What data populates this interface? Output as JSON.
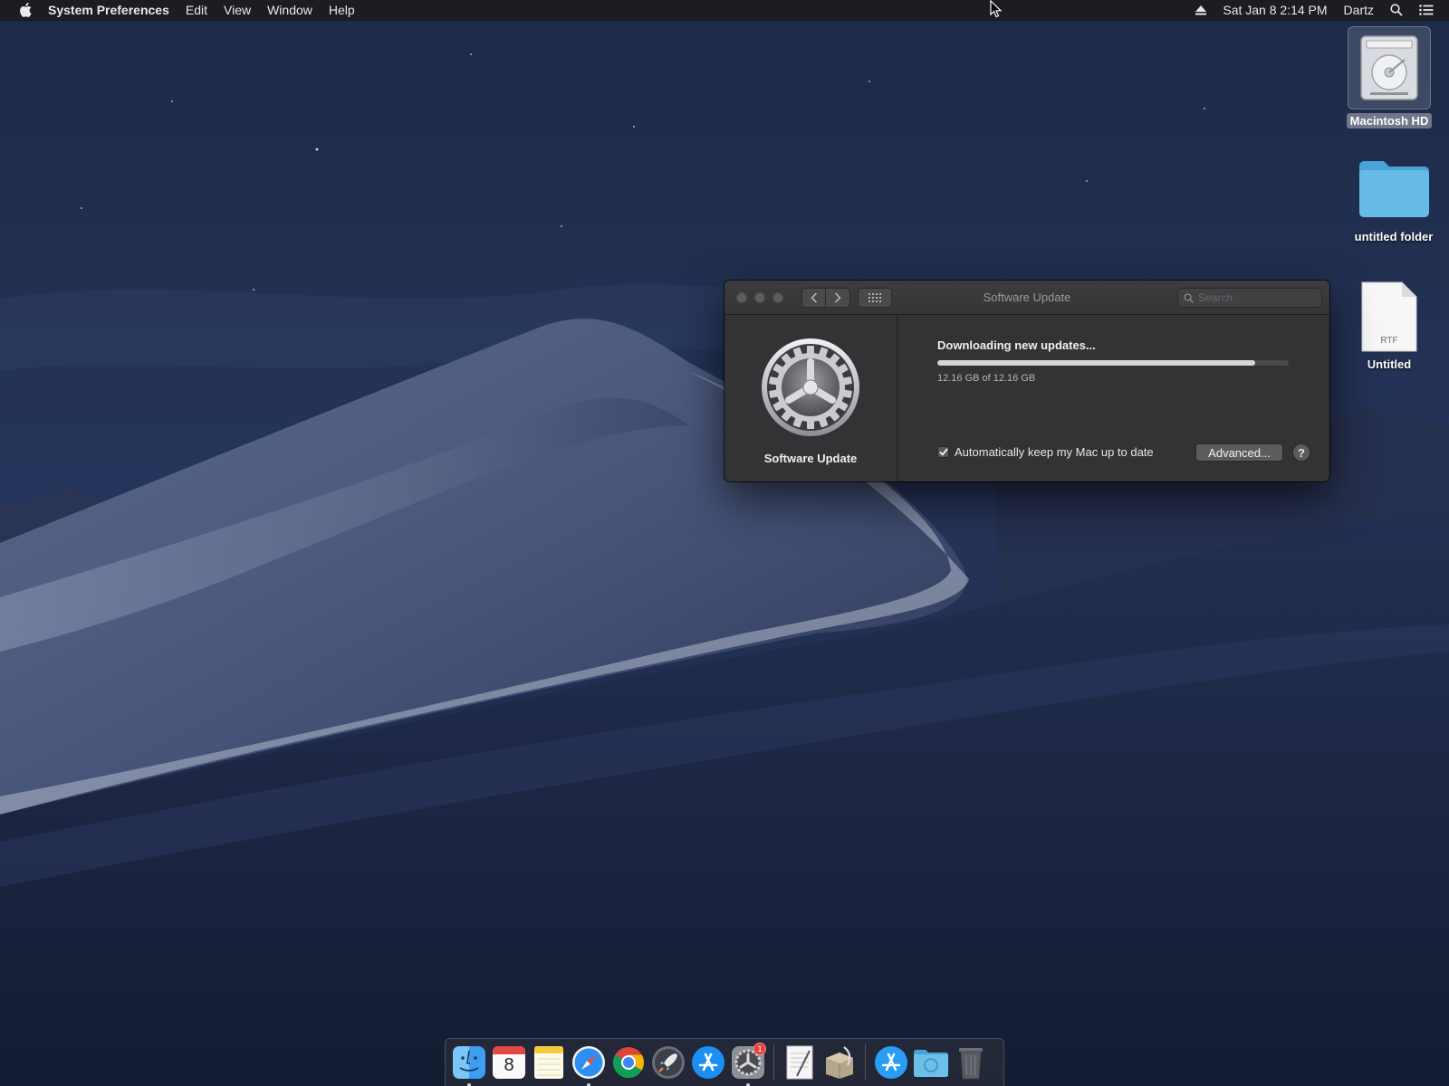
{
  "menubar": {
    "app_name": "System Preferences",
    "menus": [
      "Edit",
      "View",
      "Window",
      "Help"
    ],
    "date_time": "Sat Jan 8  2:14 PM",
    "user": "Dartz"
  },
  "desktop": {
    "icons": [
      {
        "label": "Macintosh HD",
        "icon": "hard-drive-icon",
        "selected": true
      },
      {
        "label": "untitled folder",
        "icon": "folder-icon",
        "selected": false
      },
      {
        "label": "Untitled",
        "icon": "rtf-document-icon",
        "file_badge": "RTF",
        "selected": false
      }
    ]
  },
  "window": {
    "title": "Software Update",
    "search_placeholder": "Search",
    "pane": {
      "name": "Software Update",
      "icon": "gear-icon",
      "status": "Downloading new updates...",
      "progress_fraction": 0.905,
      "progress_text": "12.16 GB of 12.16 GB",
      "auto_update_label": "Automatically keep my Mac up to date",
      "auto_update_checked": true,
      "advanced_label": "Advanced...",
      "help_label": "?"
    }
  },
  "dock": {
    "items": [
      {
        "name": "finder-icon",
        "running": true
      },
      {
        "name": "calendar-icon",
        "text": "8",
        "running": false
      },
      {
        "name": "notes-icon",
        "running": false
      },
      {
        "name": "safari-icon",
        "running": true
      },
      {
        "name": "chrome-icon",
        "running": false
      },
      {
        "name": "launchpad-icon",
        "running": false
      },
      {
        "name": "app-store-icon",
        "running": false
      },
      {
        "name": "system-preferences-icon",
        "running": true,
        "badge": "1"
      },
      {
        "name": "textedit-icon",
        "running": false
      },
      {
        "name": "installer-icon",
        "running": false
      },
      {
        "name": "app-store-downloads-icon",
        "running": false
      },
      {
        "name": "downloads-folder-icon",
        "running": false
      },
      {
        "name": "trash-icon",
        "running": false
      }
    ]
  },
  "colors": {
    "menubar_bg": "#1c1c20",
    "window_bg": "#333335",
    "progress_fill": "#d6d6d8",
    "folder_blue": "#5fb6e4",
    "badge_red": "#e8403a"
  }
}
